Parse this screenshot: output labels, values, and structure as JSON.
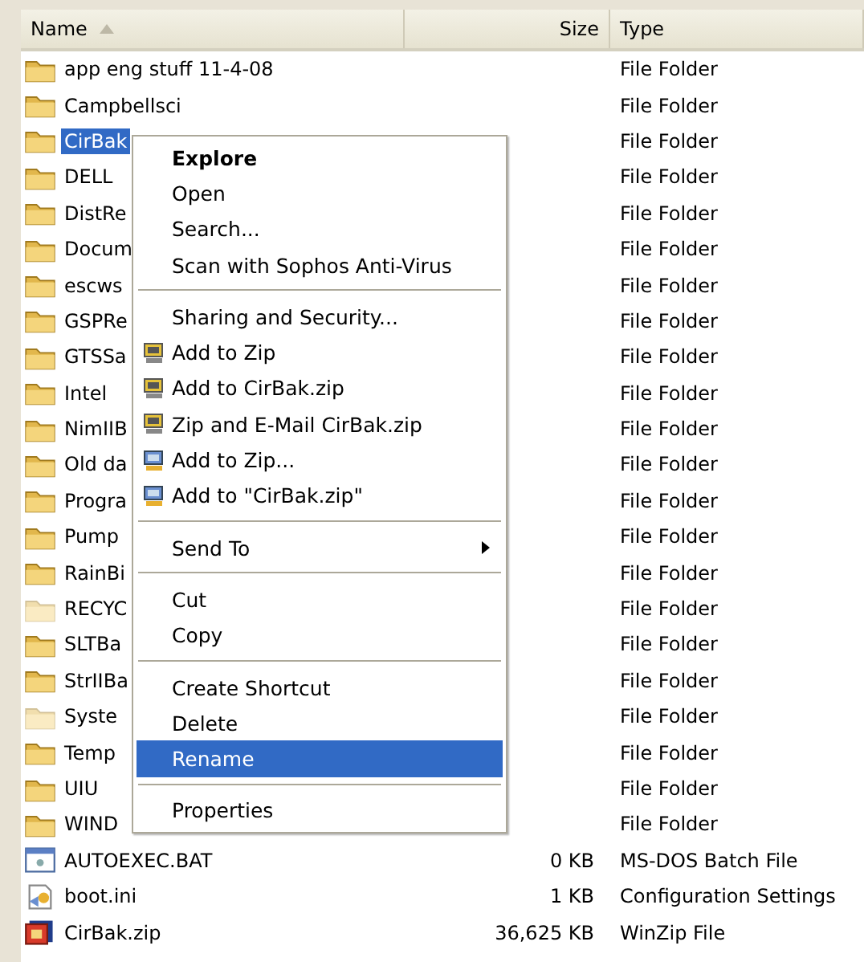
{
  "columns": [
    {
      "label": "Name",
      "sorted": true
    },
    {
      "label": "Size"
    },
    {
      "label": "Type"
    }
  ],
  "rows": [
    {
      "name": "app eng stuff 11-4-08",
      "size": "",
      "type": "File Folder",
      "kind": "folder",
      "selected": false
    },
    {
      "name": "Campbellsci",
      "size": "",
      "type": "File Folder",
      "kind": "folder",
      "selected": false
    },
    {
      "name": "CirBak",
      "size": "",
      "type": "File Folder",
      "kind": "folder",
      "selected": true
    },
    {
      "name": "DELL",
      "size": "",
      "type": "File Folder",
      "kind": "folder",
      "selected": false
    },
    {
      "name": "DistRe",
      "size": "",
      "type": "File Folder",
      "kind": "folder",
      "selected": false
    },
    {
      "name": "Docum",
      "size": "",
      "type": "File Folder",
      "kind": "folder",
      "selected": false
    },
    {
      "name": "escws",
      "size": "",
      "type": "File Folder",
      "kind": "folder",
      "selected": false
    },
    {
      "name": "GSPRe",
      "size": "",
      "type": "File Folder",
      "kind": "folder",
      "selected": false
    },
    {
      "name": "GTSSa",
      "size": "",
      "type": "File Folder",
      "kind": "folder",
      "selected": false
    },
    {
      "name": "Intel",
      "size": "",
      "type": "File Folder",
      "kind": "folder",
      "selected": false
    },
    {
      "name": "NimIIB",
      "size": "",
      "type": "File Folder",
      "kind": "folder",
      "selected": false
    },
    {
      "name": "Old da",
      "size": "",
      "type": "File Folder",
      "kind": "folder",
      "selected": false
    },
    {
      "name": "Progra",
      "size": "",
      "type": "File Folder",
      "kind": "folder",
      "selected": false
    },
    {
      "name": "Pump",
      "size": "",
      "type": "File Folder",
      "kind": "folder",
      "selected": false
    },
    {
      "name": "RainBi",
      "size": "",
      "type": "File Folder",
      "kind": "folder",
      "selected": false
    },
    {
      "name": "RECYC",
      "size": "",
      "type": "File Folder",
      "kind": "hidden-folder",
      "selected": false
    },
    {
      "name": "SLTBa",
      "size": "",
      "type": "File Folder",
      "kind": "folder",
      "selected": false
    },
    {
      "name": "StrIIBa",
      "size": "",
      "type": "File Folder",
      "kind": "folder",
      "selected": false
    },
    {
      "name": "Syste",
      "size": "",
      "type": "File Folder",
      "kind": "hidden-folder",
      "selected": false
    },
    {
      "name": "Temp",
      "size": "",
      "type": "File Folder",
      "kind": "folder",
      "selected": false
    },
    {
      "name": "UIU",
      "size": "",
      "type": "File Folder",
      "kind": "folder",
      "selected": false
    },
    {
      "name": "WIND",
      "size": "",
      "type": "File Folder",
      "kind": "folder",
      "selected": false
    },
    {
      "name": "AUTOEXEC.BAT",
      "size": "0 KB",
      "type": "MS-DOS Batch File",
      "kind": "batch",
      "selected": false
    },
    {
      "name": "boot.ini",
      "size": "1 KB",
      "type": "Configuration Settings",
      "kind": "settings",
      "selected": false
    },
    {
      "name": "CirBak.zip",
      "size": "36,625 KB",
      "type": "WinZip File",
      "kind": "zip",
      "selected": false
    }
  ],
  "context_menu": {
    "groups": [
      [
        {
          "label": "Explore",
          "kind": "default",
          "selected": false
        },
        {
          "label": "Open",
          "kind": "plain",
          "selected": false
        },
        {
          "label": "Search...",
          "kind": "plain",
          "selected": false
        },
        {
          "label": "Scan with Sophos Anti-Virus",
          "kind": "plain",
          "selected": false
        }
      ],
      [
        {
          "label": "Sharing and Security...",
          "kind": "plain",
          "selected": false
        },
        {
          "label": "Add to Zip",
          "kind": "winzip",
          "selected": false
        },
        {
          "label": "Add to CirBak.zip",
          "kind": "winzip",
          "selected": false
        },
        {
          "label": "Zip and E-Mail CirBak.zip",
          "kind": "winzip",
          "selected": false
        },
        {
          "label": "Add to Zip...",
          "kind": "archiver",
          "selected": false
        },
        {
          "label": "Add to \"CirBak.zip\"",
          "kind": "archiver",
          "selected": false
        }
      ],
      [
        {
          "label": "Send To",
          "kind": "submenu",
          "selected": false
        }
      ],
      [
        {
          "label": "Cut",
          "kind": "plain",
          "selected": false
        },
        {
          "label": "Copy",
          "kind": "plain",
          "selected": false
        }
      ],
      [
        {
          "label": "Create Shortcut",
          "kind": "plain",
          "selected": false
        },
        {
          "label": "Delete",
          "kind": "plain",
          "selected": false
        },
        {
          "label": "Rename",
          "kind": "plain",
          "selected": true
        }
      ],
      [
        {
          "label": "Properties",
          "kind": "plain",
          "selected": false
        }
      ]
    ]
  }
}
